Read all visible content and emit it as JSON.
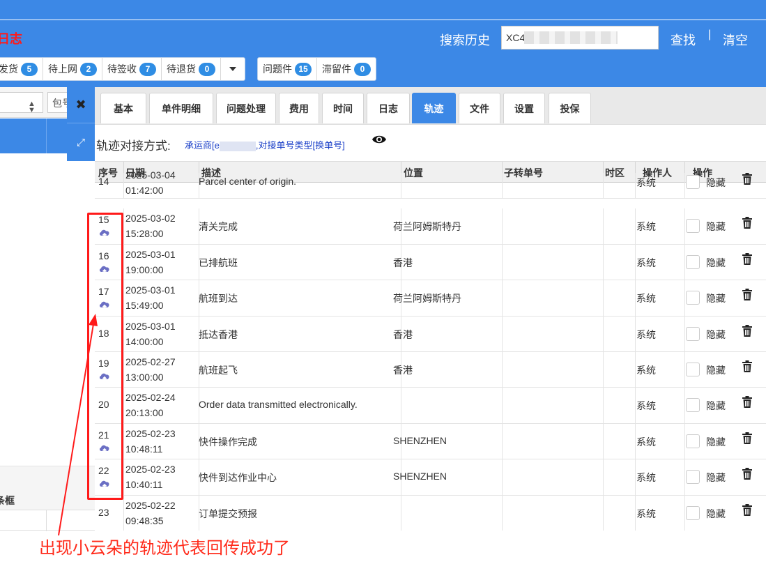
{
  "header": {
    "title_fragment": "日志",
    "search_history_label": "搜索历史",
    "search_value": "XC4",
    "find_label": "查找",
    "separator": "|",
    "clear_label": "清空"
  },
  "status_tabs": [
    {
      "label": "发货",
      "count": "5"
    },
    {
      "label": "待上网",
      "count": "2"
    },
    {
      "label": "待签收",
      "count": "7"
    },
    {
      "label": "待退货",
      "count": "0"
    }
  ],
  "problem_tabs": [
    {
      "label": "问题件",
      "count": "15"
    },
    {
      "label": "滞留件",
      "count": "0"
    }
  ],
  "left_panel": {
    "pack_label": "包号",
    "frame_label": "条框"
  },
  "tabs": [
    {
      "label": "基本"
    },
    {
      "label": "单件明细"
    },
    {
      "label": "问题处理"
    },
    {
      "label": "费用"
    },
    {
      "label": "时间"
    },
    {
      "label": "日志"
    },
    {
      "label": "轨迹",
      "active": true
    },
    {
      "label": "文件"
    },
    {
      "label": "设置"
    },
    {
      "label": "投保"
    }
  ],
  "track_mode": {
    "label": "轨迹对接方式:",
    "carrier_prefix": "承运商[e",
    "carrier_suffix": ",对接单号类型[换单号]"
  },
  "table": {
    "columns": [
      "序号",
      "日期",
      "描述",
      "位置",
      "子转单号",
      "时区",
      "操作人",
      "操作"
    ],
    "rows": [
      {
        "no": "14",
        "date": "2025-03-04",
        "time": "01:42:00",
        "desc": "Parcel center of origin.",
        "loc": "",
        "operator": "系统",
        "hide": "隐藏",
        "cloud": false
      },
      {
        "no": "15",
        "date": "2025-03-02",
        "time": "15:28:00",
        "desc": "清关完成",
        "loc": "荷兰阿姆斯特丹",
        "operator": "系统",
        "hide": "隐藏",
        "cloud": true
      },
      {
        "no": "16",
        "date": "2025-03-01",
        "time": "19:00:00",
        "desc": "已排航班",
        "loc": "香港",
        "operator": "系统",
        "hide": "隐藏",
        "cloud": true
      },
      {
        "no": "17",
        "date": "2025-03-01",
        "time": "15:49:00",
        "desc": "航班到达",
        "loc": "荷兰阿姆斯特丹",
        "operator": "系统",
        "hide": "隐藏",
        "cloud": true
      },
      {
        "no": "18",
        "date": "2025-03-01",
        "time": "14:00:00",
        "desc": "抵达香港",
        "loc": "香港",
        "operator": "系统",
        "hide": "隐藏",
        "cloud": false
      },
      {
        "no": "19",
        "date": "2025-02-27",
        "time": "13:00:00",
        "desc": "航班起飞",
        "loc": "香港",
        "operator": "系统",
        "hide": "隐藏",
        "cloud": true
      },
      {
        "no": "20",
        "date": "2025-02-24",
        "time": "20:13:00",
        "desc": "Order data transmitted electronically.",
        "loc": "",
        "operator": "系统",
        "hide": "隐藏",
        "cloud": false
      },
      {
        "no": "21",
        "date": "2025-02-23",
        "time": "10:48:11",
        "desc": "快件操作完成",
        "loc": "SHENZHEN",
        "operator": "系统",
        "hide": "隐藏",
        "cloud": true
      },
      {
        "no": "22",
        "date": "2025-02-23",
        "time": "10:40:11",
        "desc": "快件到达作业中心",
        "loc": "SHENZHEN",
        "operator": "系统",
        "hide": "隐藏",
        "cloud": true
      },
      {
        "no": "23",
        "date": "2025-02-22",
        "time": "09:48:35",
        "desc": "订单提交预报",
        "loc": "",
        "operator": "系统",
        "hide": "隐藏",
        "cloud": false
      }
    ]
  },
  "annotation": {
    "text": "出现小云朵的轨迹代表回传成功了",
    "color": "#ff1a1a"
  },
  "colors": {
    "brand_blue": "#3c88e6",
    "badge_blue": "#2f8de4",
    "cloud_purple": "#6b6fc4",
    "link_blue": "#1a3fc8"
  }
}
